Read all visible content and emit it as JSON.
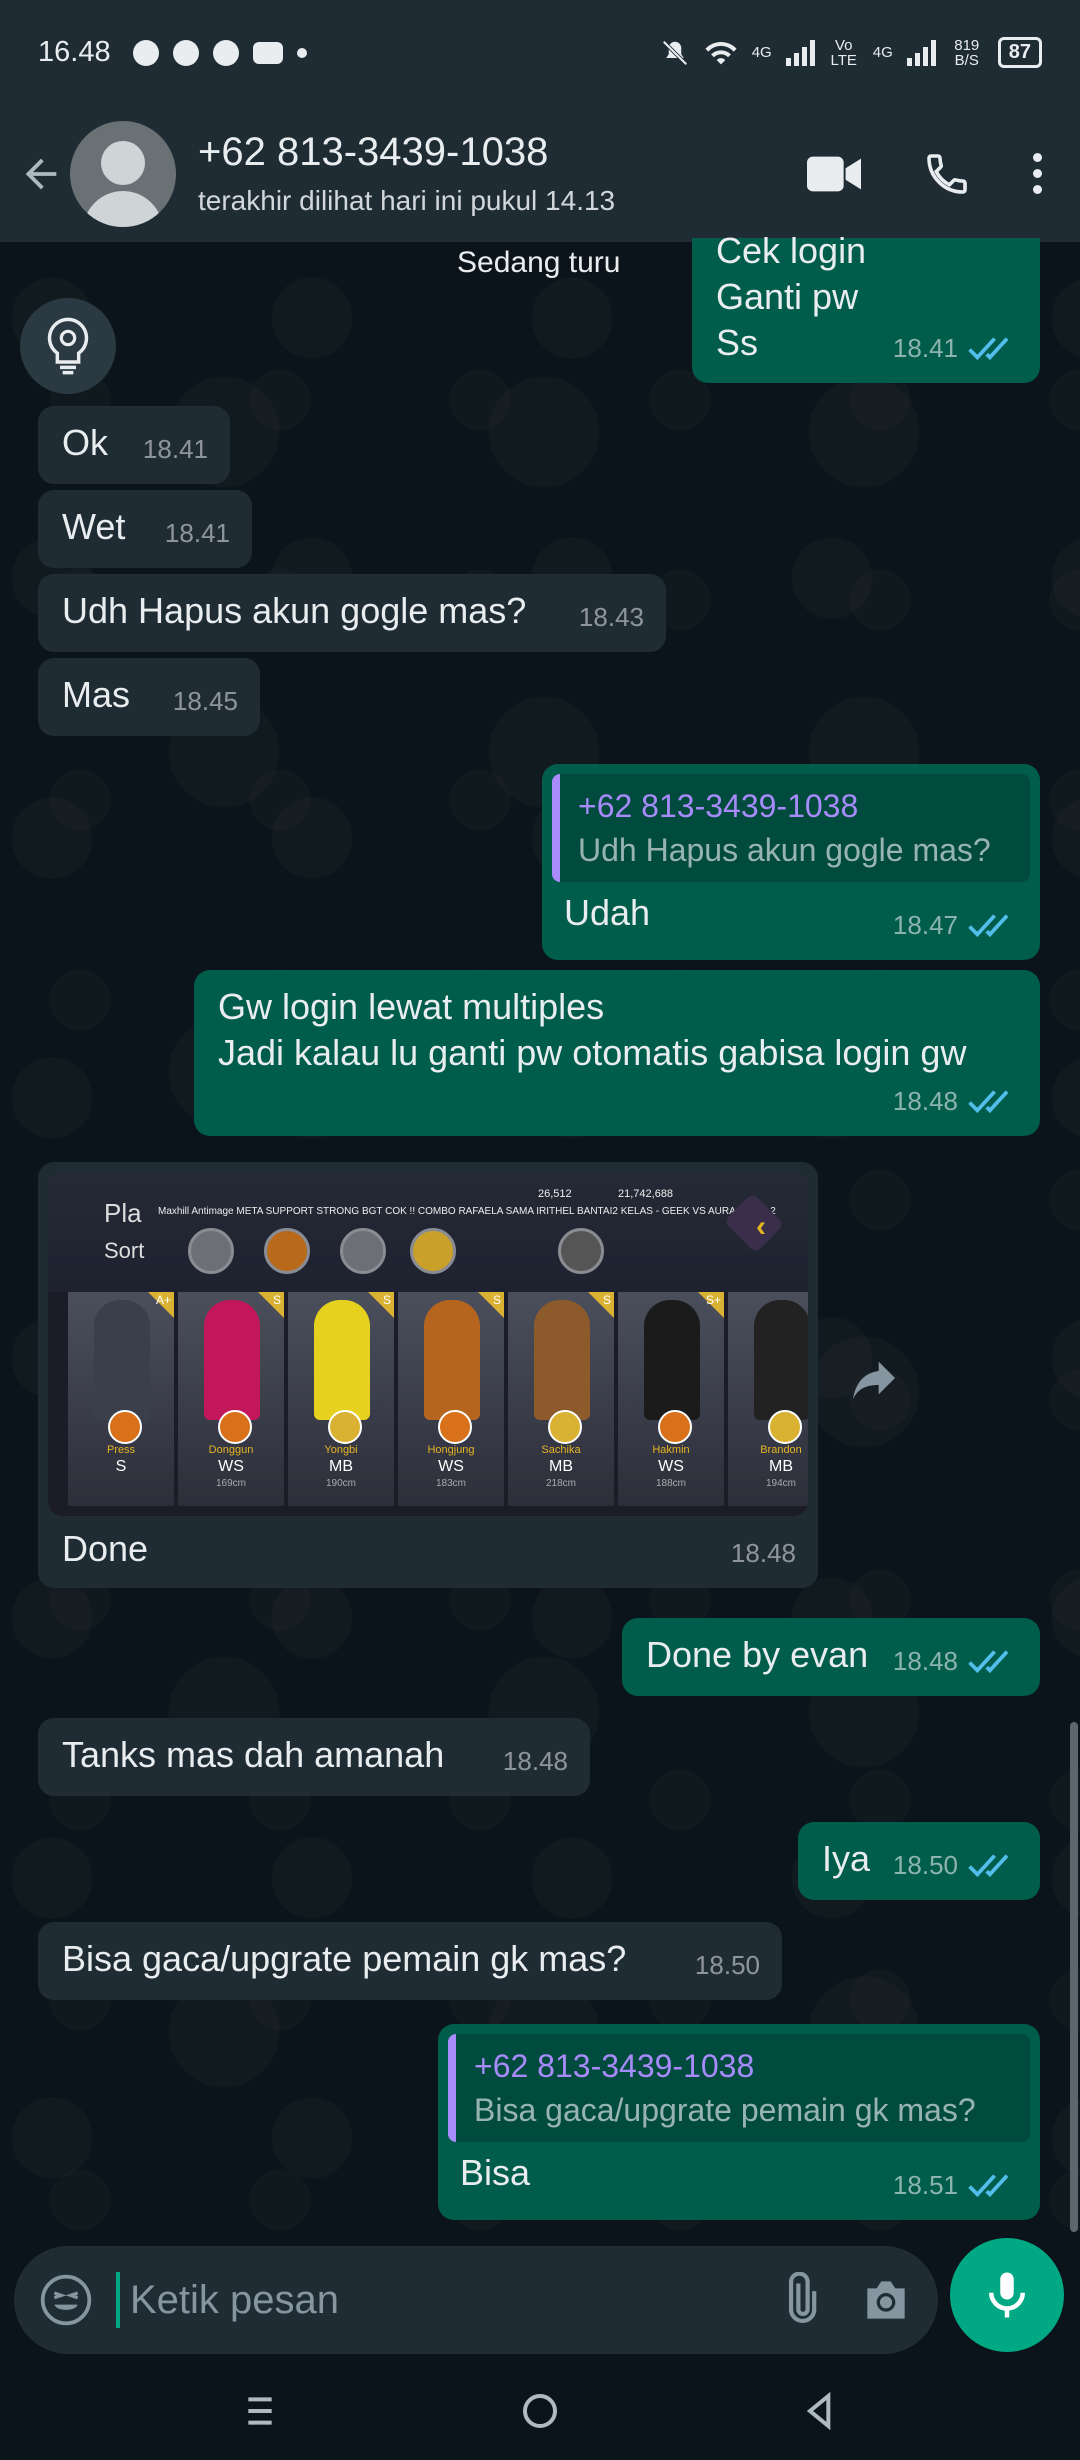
{
  "status_bar": {
    "time": "16.48",
    "network_4g_1": "4G",
    "volte": "Vo LTE",
    "network_4g_2": "4G",
    "speed": "819 B/S",
    "battery": "87"
  },
  "header": {
    "contact_name": "+62 813-3439-1038",
    "last_seen": "terakhir dilihat hari ini pukul 14.13"
  },
  "top_fragment": {
    "in_text": "Sedang turu",
    "out_lines": [
      "Cek login",
      "Ganti pw",
      "Ss"
    ],
    "out_time": "18.41"
  },
  "messages": [
    {
      "text": "Ok",
      "time": "18.41"
    },
    {
      "text": "Wet",
      "time": "18.41"
    },
    {
      "text": "Udh Hapus akun gogle mas?",
      "time": "18.43"
    },
    {
      "text": "Mas",
      "time": "18.45"
    },
    {
      "quote_name": "+62 813-3439-1038",
      "quote_text": "Udh Hapus akun gogle mas?",
      "text": "Udah",
      "time": "18.47"
    },
    {
      "line1": "Gw login lewat multiples",
      "line2": "Jadi kalau lu ganti pw otomatis gabisa login gw",
      "time": "18.48"
    },
    {
      "text": "Done",
      "time": "18.48"
    },
    {
      "text": "Done by evan",
      "time": "18.48"
    },
    {
      "text": "Tanks mas dah amanah",
      "time": "18.48"
    },
    {
      "text": "Iya",
      "time": "18.50"
    },
    {
      "text": "Bisa gaca/upgrate pemain gk mas?",
      "time": "18.50"
    },
    {
      "quote_name": "+62 813-3439-1038",
      "quote_text": "Bisa gaca/upgrate pemain gk mas?",
      "text": "Bisa",
      "time": "18.51"
    }
  ],
  "game_image": {
    "title": "Pla",
    "sort": "Sort",
    "marquee": "Maxhill Antimage META SUPPORT STRONG BGT COK !! COMBO RAFAELA SAMA IRITHEL BANTAI2 KELAS - GEEK VS AURA GAME 2",
    "stat1": "26,512",
    "stat2": "21,742,688",
    "cards": [
      {
        "name": "Press",
        "pos": "S",
        "height": "",
        "tag": "A+",
        "color": "#3a3f4c",
        "badge": "#d9701a"
      },
      {
        "name": "Donggun",
        "pos": "WS",
        "height": "169cm",
        "tag": "S",
        "color": "#c2185b",
        "badge": "#d9701a"
      },
      {
        "name": "Yongbi",
        "pos": "MB",
        "height": "190cm",
        "tag": "S",
        "color": "#e6d21e",
        "badge": "#d9b233"
      },
      {
        "name": "Hongjung",
        "pos": "WS",
        "height": "183cm",
        "tag": "S",
        "color": "#b5651d",
        "badge": "#d9701a"
      },
      {
        "name": "Sachika",
        "pos": "MB",
        "height": "218cm",
        "tag": "S",
        "color": "#8d5a2b",
        "badge": "#d9b233"
      },
      {
        "name": "Hakmin",
        "pos": "WS",
        "height": "188cm",
        "tag": "S+",
        "color": "#1b1b1b",
        "badge": "#d9701a"
      },
      {
        "name": "Brandon",
        "pos": "MB",
        "height": "194cm",
        "tag": "S",
        "color": "#222222",
        "badge": "#d9b233"
      }
    ]
  },
  "input": {
    "placeholder": "Ketik pesan"
  },
  "colors": {
    "incoming": "#202c33",
    "outgoing": "#005c4b",
    "accent": "#00a884",
    "quote_accent": "#a78bfa",
    "read_ticks": "#53bdeb"
  }
}
